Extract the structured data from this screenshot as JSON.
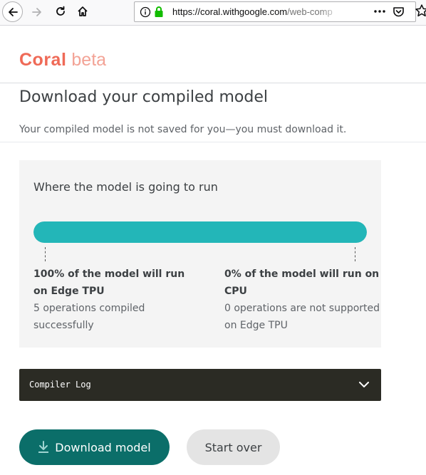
{
  "browser": {
    "url_host": "https://coral.withgoogle.com",
    "url_path": "/web-comp"
  },
  "brand": {
    "name": "Coral",
    "tag": "beta"
  },
  "page": {
    "title": "Download your compiled model",
    "subtitle": "Your compiled model is not saved for you—you must download it."
  },
  "run_panel": {
    "title": "Where the model is going to run",
    "tpu_fraction": 1.0,
    "tpu": {
      "headline": "100% of the model will run on Edge TPU",
      "detail": "5 operations compiled successfully"
    },
    "cpu": {
      "headline": "0% of the model will run on CPU",
      "detail": "0 operations are not supported on Edge TPU"
    }
  },
  "compiler_log": {
    "label": "Compiler Log"
  },
  "actions": {
    "download_label": "Download model",
    "start_over_label": "Start over"
  },
  "colors": {
    "brand": "#ef6a57",
    "bar": "#23b6b8",
    "primary_button": "#0b6e69",
    "log_bg": "#2b2b24"
  },
  "icons": {
    "back": "arrow-left-icon",
    "forward": "arrow-right-icon",
    "reload": "reload-icon",
    "home": "home-icon",
    "info": "info-icon",
    "lock": "lock-icon",
    "more": "more-icon",
    "pocket": "pocket-icon",
    "bookmark": "star-icon",
    "expand": "chevron-down-icon",
    "download": "download-icon"
  }
}
